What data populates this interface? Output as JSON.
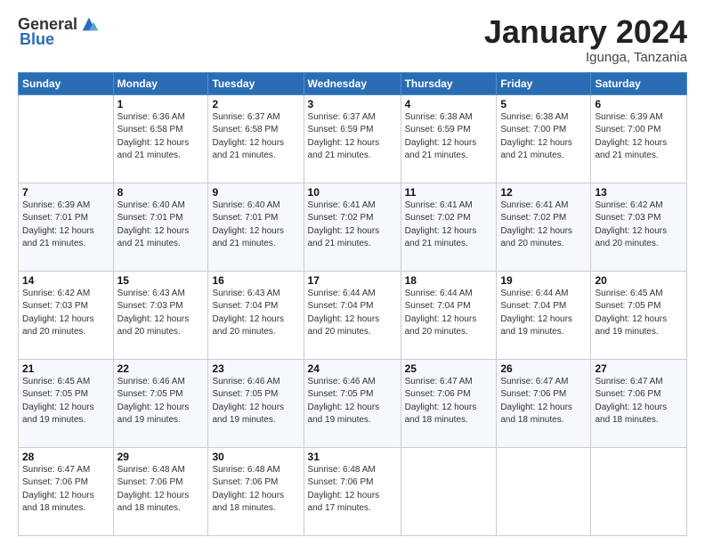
{
  "logo": {
    "general": "General",
    "blue": "Blue"
  },
  "title": "January 2024",
  "location": "Igunga, Tanzania",
  "days_header": [
    "Sunday",
    "Monday",
    "Tuesday",
    "Wednesday",
    "Thursday",
    "Friday",
    "Saturday"
  ],
  "weeks": [
    [
      {
        "day": "",
        "sunrise": "",
        "sunset": "",
        "daylight": ""
      },
      {
        "day": "1",
        "sunrise": "Sunrise: 6:36 AM",
        "sunset": "Sunset: 6:58 PM",
        "daylight": "Daylight: 12 hours and 21 minutes."
      },
      {
        "day": "2",
        "sunrise": "Sunrise: 6:37 AM",
        "sunset": "Sunset: 6:58 PM",
        "daylight": "Daylight: 12 hours and 21 minutes."
      },
      {
        "day": "3",
        "sunrise": "Sunrise: 6:37 AM",
        "sunset": "Sunset: 6:59 PM",
        "daylight": "Daylight: 12 hours and 21 minutes."
      },
      {
        "day": "4",
        "sunrise": "Sunrise: 6:38 AM",
        "sunset": "Sunset: 6:59 PM",
        "daylight": "Daylight: 12 hours and 21 minutes."
      },
      {
        "day": "5",
        "sunrise": "Sunrise: 6:38 AM",
        "sunset": "Sunset: 7:00 PM",
        "daylight": "Daylight: 12 hours and 21 minutes."
      },
      {
        "day": "6",
        "sunrise": "Sunrise: 6:39 AM",
        "sunset": "Sunset: 7:00 PM",
        "daylight": "Daylight: 12 hours and 21 minutes."
      }
    ],
    [
      {
        "day": "7",
        "sunrise": "Sunrise: 6:39 AM",
        "sunset": "Sunset: 7:01 PM",
        "daylight": "Daylight: 12 hours and 21 minutes."
      },
      {
        "day": "8",
        "sunrise": "Sunrise: 6:40 AM",
        "sunset": "Sunset: 7:01 PM",
        "daylight": "Daylight: 12 hours and 21 minutes."
      },
      {
        "day": "9",
        "sunrise": "Sunrise: 6:40 AM",
        "sunset": "Sunset: 7:01 PM",
        "daylight": "Daylight: 12 hours and 21 minutes."
      },
      {
        "day": "10",
        "sunrise": "Sunrise: 6:41 AM",
        "sunset": "Sunset: 7:02 PM",
        "daylight": "Daylight: 12 hours and 21 minutes."
      },
      {
        "day": "11",
        "sunrise": "Sunrise: 6:41 AM",
        "sunset": "Sunset: 7:02 PM",
        "daylight": "Daylight: 12 hours and 21 minutes."
      },
      {
        "day": "12",
        "sunrise": "Sunrise: 6:41 AM",
        "sunset": "Sunset: 7:02 PM",
        "daylight": "Daylight: 12 hours and 20 minutes."
      },
      {
        "day": "13",
        "sunrise": "Sunrise: 6:42 AM",
        "sunset": "Sunset: 7:03 PM",
        "daylight": "Daylight: 12 hours and 20 minutes."
      }
    ],
    [
      {
        "day": "14",
        "sunrise": "Sunrise: 6:42 AM",
        "sunset": "Sunset: 7:03 PM",
        "daylight": "Daylight: 12 hours and 20 minutes."
      },
      {
        "day": "15",
        "sunrise": "Sunrise: 6:43 AM",
        "sunset": "Sunset: 7:03 PM",
        "daylight": "Daylight: 12 hours and 20 minutes."
      },
      {
        "day": "16",
        "sunrise": "Sunrise: 6:43 AM",
        "sunset": "Sunset: 7:04 PM",
        "daylight": "Daylight: 12 hours and 20 minutes."
      },
      {
        "day": "17",
        "sunrise": "Sunrise: 6:44 AM",
        "sunset": "Sunset: 7:04 PM",
        "daylight": "Daylight: 12 hours and 20 minutes."
      },
      {
        "day": "18",
        "sunrise": "Sunrise: 6:44 AM",
        "sunset": "Sunset: 7:04 PM",
        "daylight": "Daylight: 12 hours and 20 minutes."
      },
      {
        "day": "19",
        "sunrise": "Sunrise: 6:44 AM",
        "sunset": "Sunset: 7:04 PM",
        "daylight": "Daylight: 12 hours and 19 minutes."
      },
      {
        "day": "20",
        "sunrise": "Sunrise: 6:45 AM",
        "sunset": "Sunset: 7:05 PM",
        "daylight": "Daylight: 12 hours and 19 minutes."
      }
    ],
    [
      {
        "day": "21",
        "sunrise": "Sunrise: 6:45 AM",
        "sunset": "Sunset: 7:05 PM",
        "daylight": "Daylight: 12 hours and 19 minutes."
      },
      {
        "day": "22",
        "sunrise": "Sunrise: 6:46 AM",
        "sunset": "Sunset: 7:05 PM",
        "daylight": "Daylight: 12 hours and 19 minutes."
      },
      {
        "day": "23",
        "sunrise": "Sunrise: 6:46 AM",
        "sunset": "Sunset: 7:05 PM",
        "daylight": "Daylight: 12 hours and 19 minutes."
      },
      {
        "day": "24",
        "sunrise": "Sunrise: 6:46 AM",
        "sunset": "Sunset: 7:05 PM",
        "daylight": "Daylight: 12 hours and 19 minutes."
      },
      {
        "day": "25",
        "sunrise": "Sunrise: 6:47 AM",
        "sunset": "Sunset: 7:06 PM",
        "daylight": "Daylight: 12 hours and 18 minutes."
      },
      {
        "day": "26",
        "sunrise": "Sunrise: 6:47 AM",
        "sunset": "Sunset: 7:06 PM",
        "daylight": "Daylight: 12 hours and 18 minutes."
      },
      {
        "day": "27",
        "sunrise": "Sunrise: 6:47 AM",
        "sunset": "Sunset: 7:06 PM",
        "daylight": "Daylight: 12 hours and 18 minutes."
      }
    ],
    [
      {
        "day": "28",
        "sunrise": "Sunrise: 6:47 AM",
        "sunset": "Sunset: 7:06 PM",
        "daylight": "Daylight: 12 hours and 18 minutes."
      },
      {
        "day": "29",
        "sunrise": "Sunrise: 6:48 AM",
        "sunset": "Sunset: 7:06 PM",
        "daylight": "Daylight: 12 hours and 18 minutes."
      },
      {
        "day": "30",
        "sunrise": "Sunrise: 6:48 AM",
        "sunset": "Sunset: 7:06 PM",
        "daylight": "Daylight: 12 hours and 18 minutes."
      },
      {
        "day": "31",
        "sunrise": "Sunrise: 6:48 AM",
        "sunset": "Sunset: 7:06 PM",
        "daylight": "Daylight: 12 hours and 17 minutes."
      },
      {
        "day": "",
        "sunrise": "",
        "sunset": "",
        "daylight": ""
      },
      {
        "day": "",
        "sunrise": "",
        "sunset": "",
        "daylight": ""
      },
      {
        "day": "",
        "sunrise": "",
        "sunset": "",
        "daylight": ""
      }
    ]
  ]
}
